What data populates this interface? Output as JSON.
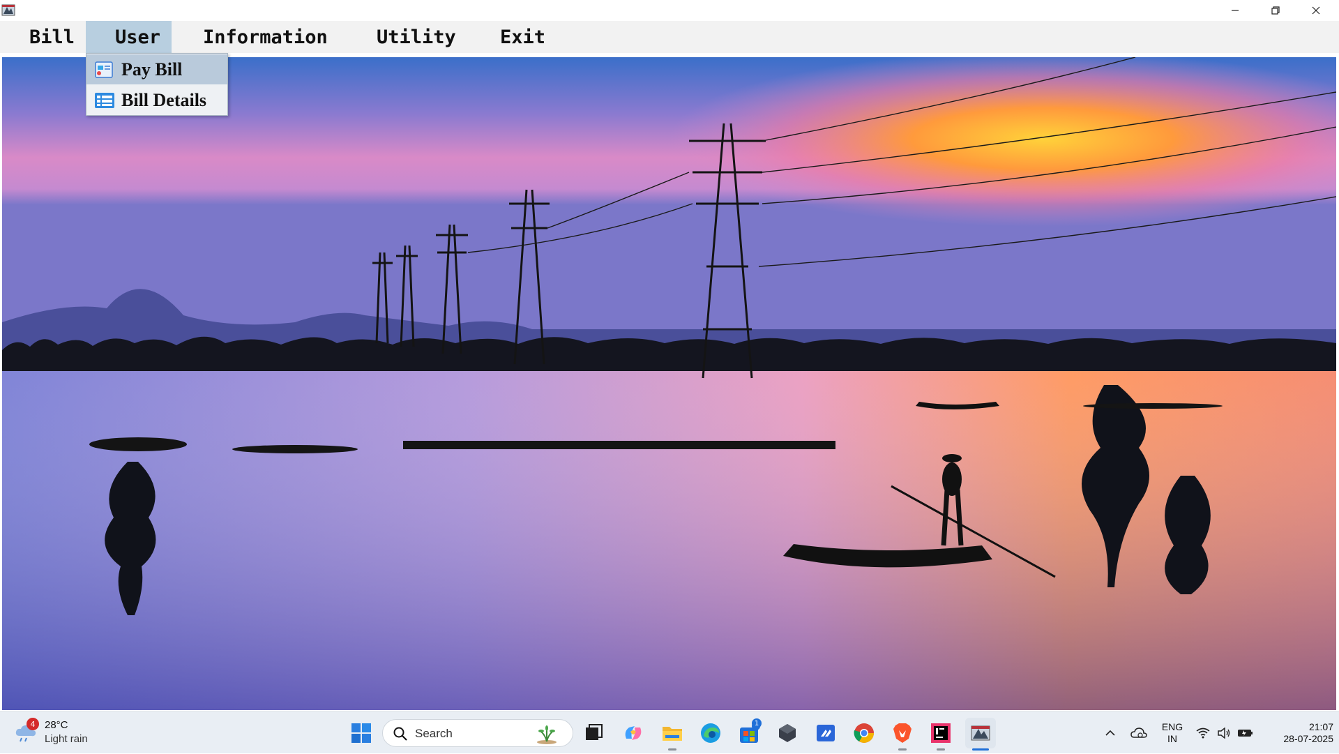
{
  "window": {
    "controls": {
      "minimize_icon": "minimize-icon",
      "maximize_icon": "restore-icon",
      "close_icon": "close-icon"
    }
  },
  "menubar": {
    "items": [
      {
        "label": "Bill"
      },
      {
        "label": "User",
        "active": true
      },
      {
        "label": "Information"
      },
      {
        "label": "Utility"
      },
      {
        "label": "Exit"
      }
    ]
  },
  "dropdown": {
    "items": [
      {
        "label": "Pay Bill",
        "icon": "pay-bill-icon",
        "highlighted": true
      },
      {
        "label": "Bill Details",
        "icon": "bill-details-icon"
      }
    ]
  },
  "taskbar": {
    "weather": {
      "badge": "4",
      "temperature": "28°C",
      "description": "Light rain"
    },
    "search": {
      "placeholder": "Search"
    },
    "tray": {
      "lang_line1": "ENG",
      "lang_line2": "IN",
      "time": "21:07",
      "date": "28-07-2025"
    },
    "store_badge": "1"
  },
  "colors": {
    "menu_active": "#b8cfe0",
    "dropdown_highlight": "#b9cadb",
    "taskbar": "#e9eef4"
  }
}
